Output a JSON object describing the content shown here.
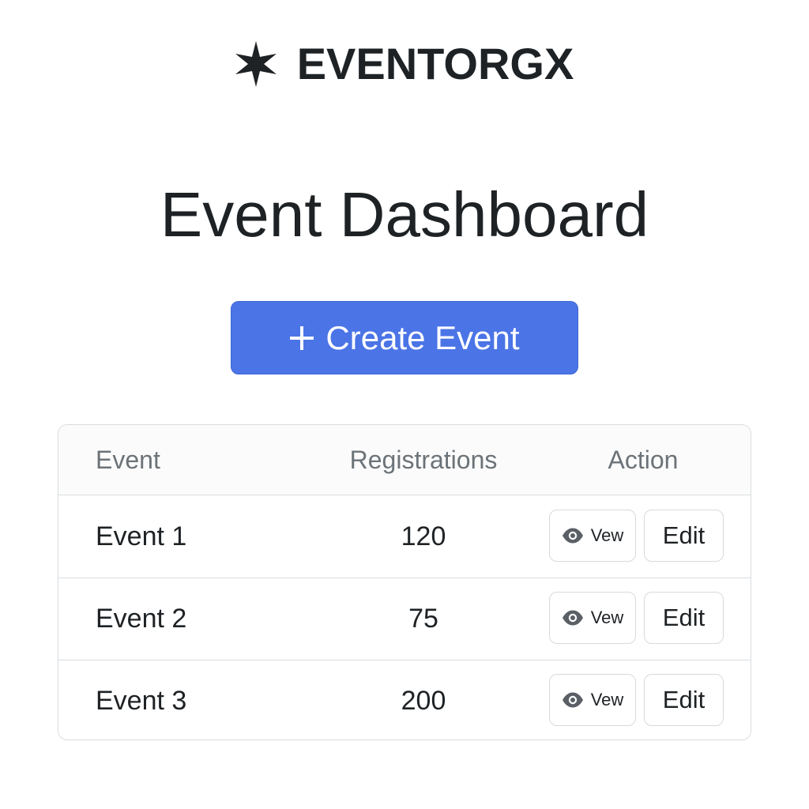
{
  "brand": {
    "icon": "star-burst-icon",
    "name": "EVENTORGX"
  },
  "page": {
    "title": "Event Dashboard"
  },
  "create_button": {
    "icon": "plus-icon",
    "label": "Create Event",
    "color": "#4b74e6"
  },
  "table": {
    "headers": [
      "Event",
      "Registrations",
      "Action"
    ],
    "rows": [
      {
        "event": "Event 1",
        "registrations": "120",
        "view_label": "Vew",
        "edit_label": "Edit"
      },
      {
        "event": "Event 2",
        "registrations": "75",
        "view_label": "Vew",
        "edit_label": "Edit"
      },
      {
        "event": "Event 3",
        "registrations": "200",
        "view_label": "Vew",
        "edit_label": "Edit"
      }
    ],
    "view_icon": "eye-icon"
  }
}
